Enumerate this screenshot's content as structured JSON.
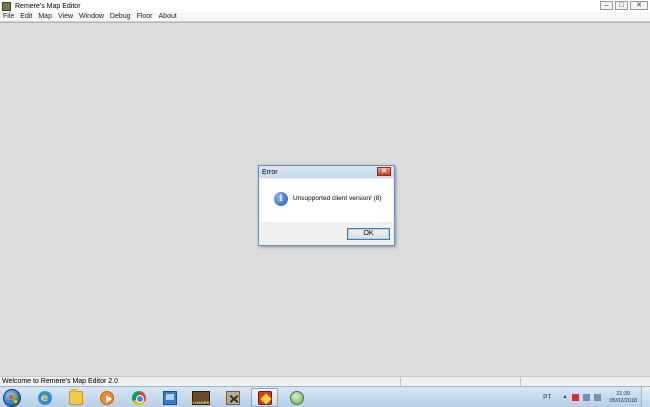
{
  "window": {
    "title": "Remere's Map Editor",
    "controls": [
      "–",
      "□",
      "✕"
    ]
  },
  "menu": [
    "File",
    "Edit",
    "Map",
    "View",
    "Window",
    "Debug",
    "Floor",
    "About"
  ],
  "dialog": {
    "title": "Error",
    "close": "✕",
    "icon_glyph": "i",
    "message": "Unsupported client version! (8)",
    "ok_label": "OK"
  },
  "statusbar": {
    "text": "Welcome to Remere's Map Editor 2.0"
  },
  "taskbar": {
    "loader_label": "LOADER",
    "tray": {
      "language": "PT",
      "arrow": "▴",
      "time": "21:39",
      "date": "05/02/2018"
    }
  }
}
